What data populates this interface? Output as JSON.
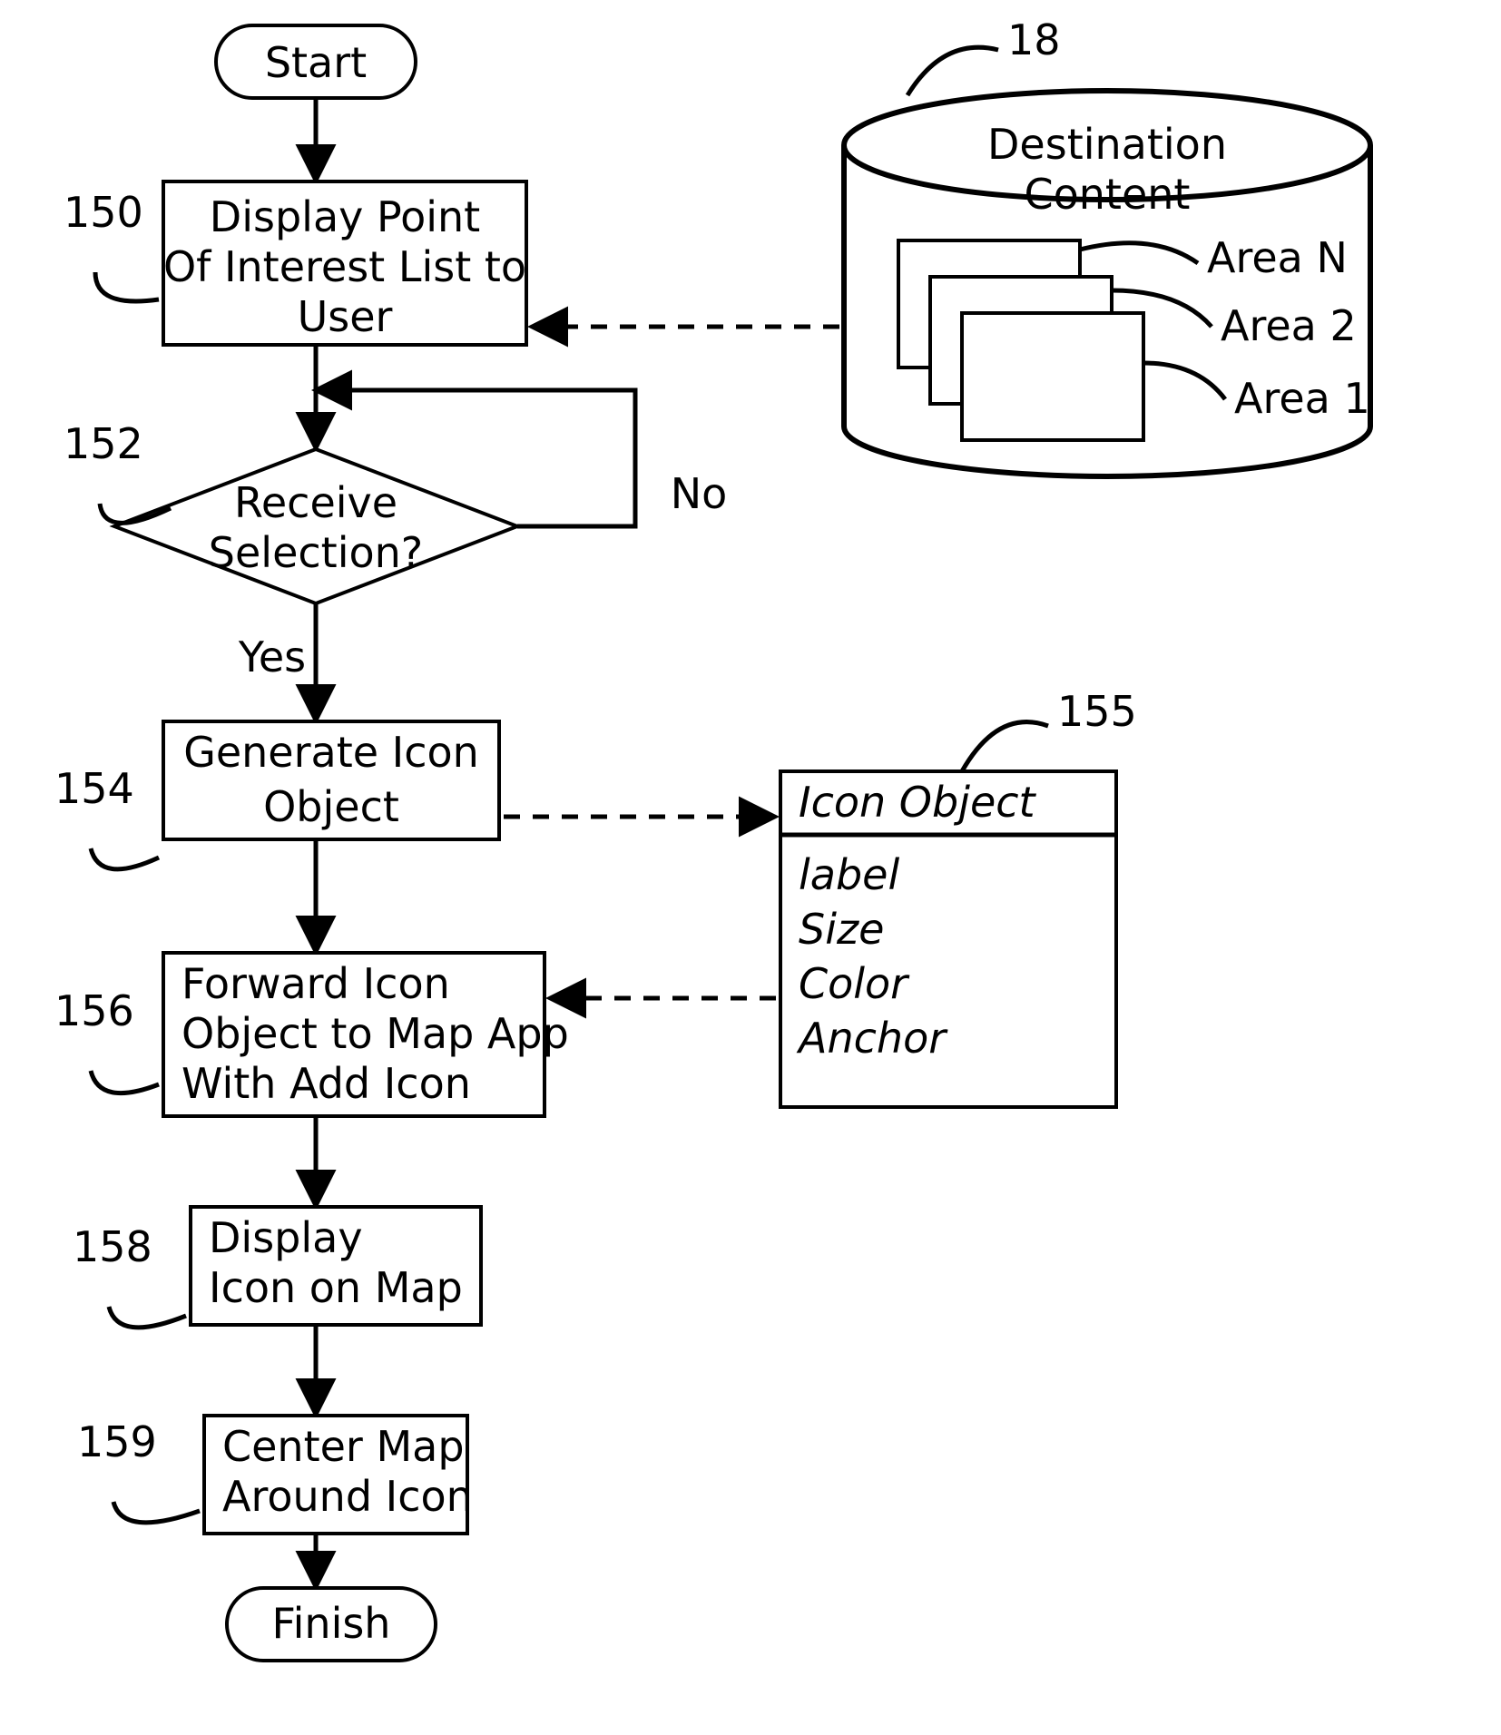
{
  "nodes": {
    "start": "Start",
    "finish": "Finish",
    "step150_l1": "Display Point",
    "step150_l2": "Of Interest List to",
    "step150_l3": "User",
    "step152_l1": "Receive",
    "step152_l2": "Selection?",
    "step154_l1": "Generate Icon",
    "step154_l2": "Object",
    "step156_l1": "Forward Icon",
    "step156_l2": "Object to Map App",
    "step156_l3": "With Add Icon",
    "step158_l1": "Display",
    "step158_l2": "Icon on Map",
    "step159_l1": "Center Map",
    "step159_l2": "Around Icon"
  },
  "labels": {
    "no": "No",
    "yes": "Yes",
    "ref150": "150",
    "ref152": "152",
    "ref154": "154",
    "ref155": "155",
    "ref156": "156",
    "ref158": "158",
    "ref159": "159",
    "ref18": "18"
  },
  "db": {
    "title_l1": "Destination",
    "title_l2": "Content",
    "area1": "Area 1",
    "area2": "Area 2",
    "areaN": "Area N"
  },
  "icon_object": {
    "title": "Icon Object",
    "f1": "label",
    "f2": "Size",
    "f3": "Color",
    "f4": "Anchor"
  }
}
